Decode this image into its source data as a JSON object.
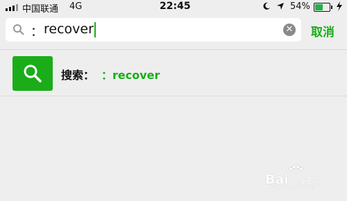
{
  "status_bar": {
    "carrier": "中国联通",
    "network": "4G",
    "time": "22:45",
    "battery_percent": "54%",
    "battery_level": 0.54,
    "icons": [
      "signal-icon",
      "moon-icon",
      "location-icon",
      "battery-icon",
      "charging-bolt-icon"
    ]
  },
  "search": {
    "prefix": "：",
    "query": "recover",
    "cancel_label": "取消"
  },
  "result": {
    "label": "搜索：",
    "query": "：recover"
  },
  "watermark": {
    "brand": "Bai",
    "sub": "经验",
    "url": "jingyan.baidu.com"
  },
  "colors": {
    "accent": "#1aad19",
    "background": "#eeeeee"
  }
}
